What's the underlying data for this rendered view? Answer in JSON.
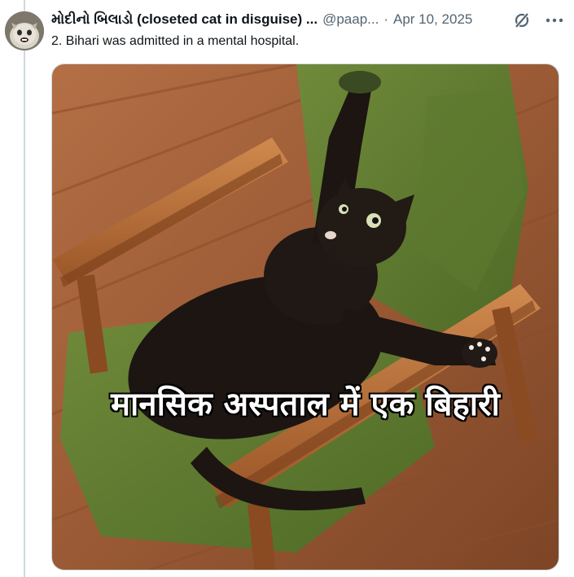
{
  "post": {
    "author": {
      "display_name": "મોદીનો બિલાડો (closeted cat in disguise) ...",
      "handle": "@paap...",
      "avatar_icon": "cat-avatar"
    },
    "separator": "·",
    "date": "Apr 10, 2025",
    "actions": {
      "grok_icon": "grok-icon",
      "more_icon": "more-options-icon"
    },
    "text": "2. Bihari was admitted in a mental hospital.",
    "media": {
      "caption": "मानसिक अस्पताल में एक बिहारी",
      "description_icon": "black-cat-on-green-armchair-image"
    }
  },
  "colors": {
    "text_primary": "#0f1419",
    "text_secondary": "#536471",
    "border": "#cfd9de",
    "thread_line": "#cfd9de"
  }
}
